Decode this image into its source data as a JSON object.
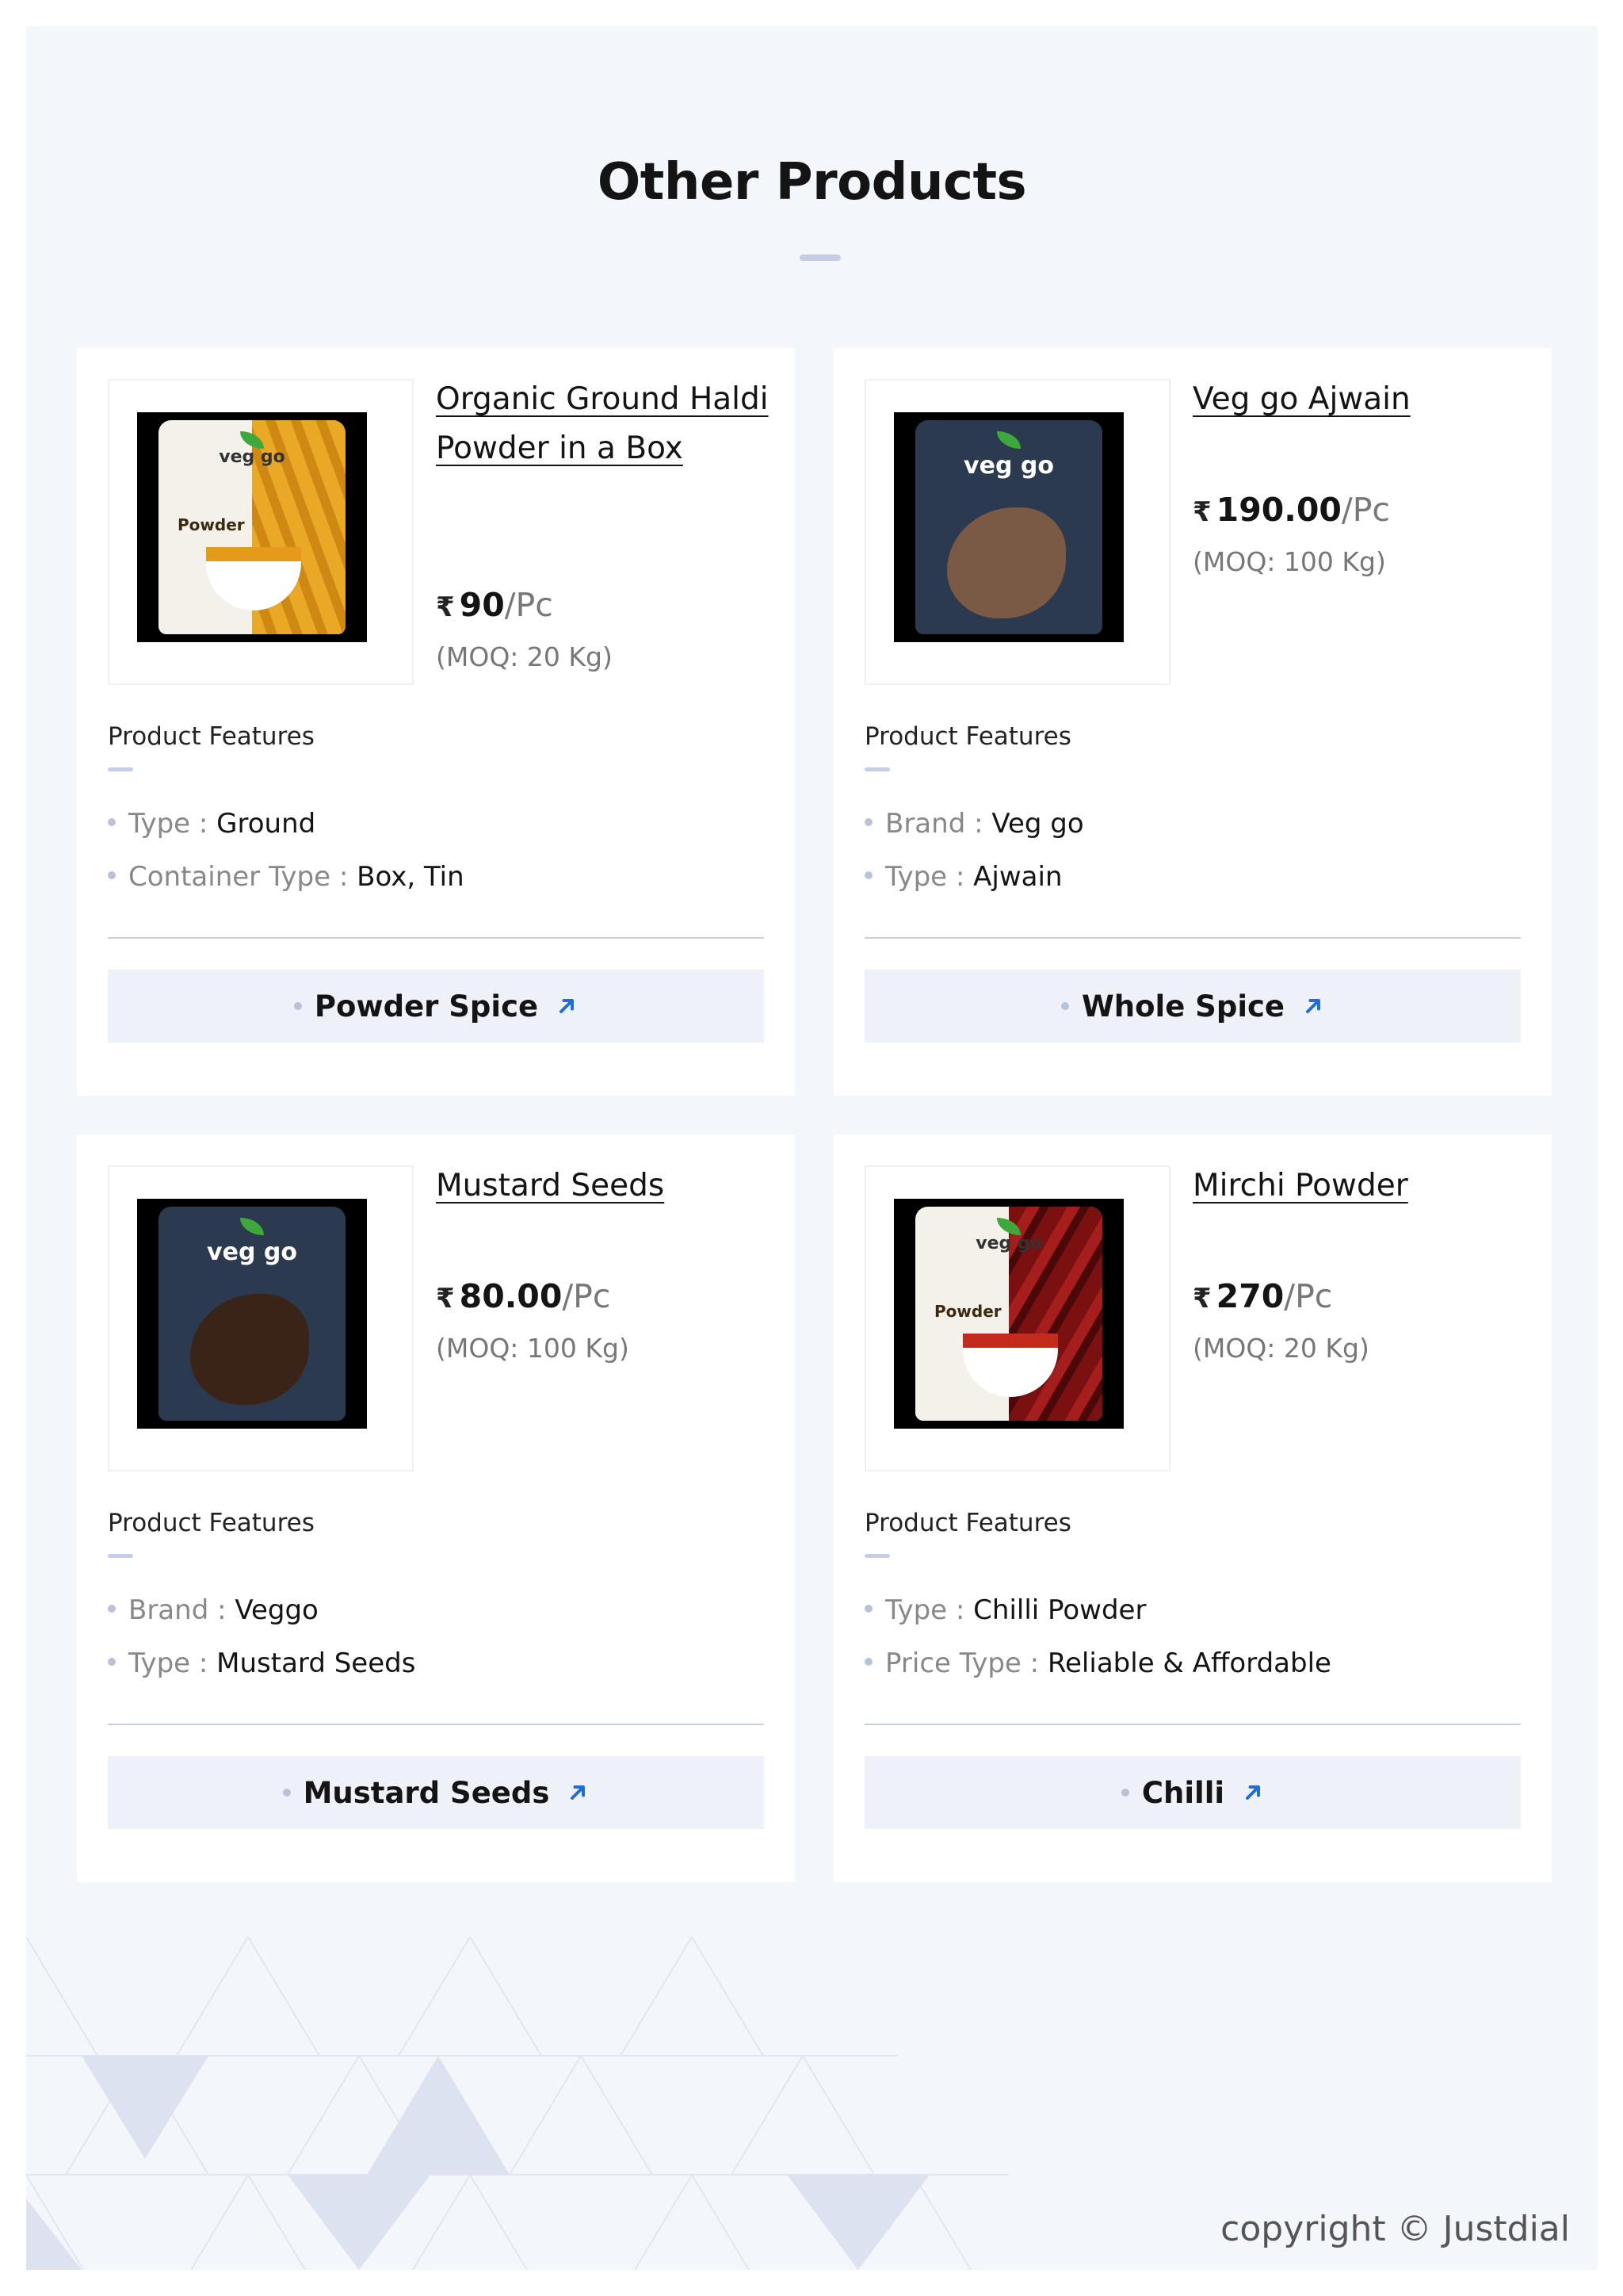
{
  "section": {
    "title": "Other Products"
  },
  "labels": {
    "features_heading": "Product Features",
    "currency_symbol": "₹"
  },
  "products": [
    {
      "name": "Organic Ground Haldi Powder in a Box",
      "price": "90",
      "unit": "/Pc",
      "moq": "(MOQ: 20 Kg)",
      "image_label": "Powder",
      "features": [
        {
          "key": "Type",
          "value": "Ground"
        },
        {
          "key": "Container Type",
          "value": "Box, Tin"
        }
      ],
      "category": "Powder Spice"
    },
    {
      "name": "Veg go Ajwain",
      "price": "190.00",
      "unit": "/Pc",
      "moq": "(MOQ: 100 Kg)",
      "image_label": "veg go",
      "features": [
        {
          "key": "Brand",
          "value": "Veg go"
        },
        {
          "key": "Type",
          "value": "Ajwain"
        }
      ],
      "category": "Whole Spice"
    },
    {
      "name": "Mustard Seeds",
      "price": "80.00",
      "unit": "/Pc",
      "moq": "(MOQ: 100 Kg)",
      "image_label": "veg go",
      "features": [
        {
          "key": "Brand",
          "value": "Veggo"
        },
        {
          "key": "Type",
          "value": "Mustard Seeds"
        }
      ],
      "category": "Mustard Seeds"
    },
    {
      "name": "Mirchi Powder",
      "price": "270",
      "unit": "/Pc",
      "moq": "(MOQ: 20 Kg)",
      "image_label": "Powder",
      "features": [
        {
          "key": "Type",
          "value": "Chilli Powder"
        },
        {
          "key": "Price Type",
          "value": "Reliable & Affordable"
        }
      ],
      "category": "Chilli"
    }
  ],
  "footer": {
    "copyright": "copyright © Justdial"
  },
  "colors": {
    "page_background": "#f3f6fb",
    "card_background": "#ffffff",
    "accent_dash": "#c4cce6",
    "arrow_blue": "#1f6fd1",
    "button_background": "#eef2f8"
  }
}
